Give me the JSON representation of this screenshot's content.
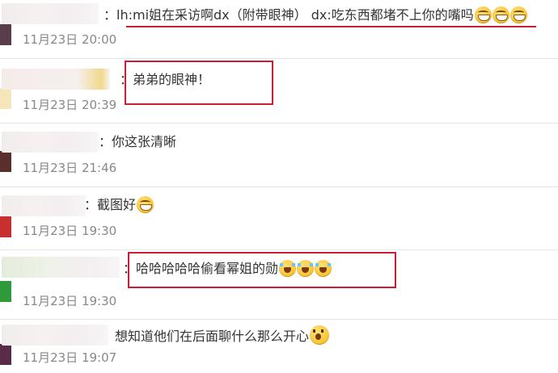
{
  "comments": [
    {
      "text": "：lh:mi姐在采访啊dx（附带眼神） dx:吃东西都堵不上你的嘴吗",
      "emojis": [
        "grin-icon",
        "grin-icon",
        "grin-icon"
      ],
      "date": "11月23日 20:00"
    },
    {
      "text": "：弟弟的眼神！",
      "emojis": [],
      "date": "11月23日 20:39"
    },
    {
      "text": "：你这张清晰",
      "emojis": [],
      "date": "11月23日 21:46"
    },
    {
      "text": "：截图好",
      "emojis": [
        "grin-icon"
      ],
      "date": "11月23日 19:30"
    },
    {
      "text": "：哈哈哈哈哈偷看幂姐的勋",
      "emojis": [
        "tears-of-joy-icon",
        "tears-of-joy-icon",
        "tears-of-joy-icon"
      ],
      "date": "11月23日 19:30"
    },
    {
      "text": "想知道他们在后面聊什么那么开心",
      "emojis": [
        "shocked-face-icon"
      ],
      "date": "11月23日 19:07"
    }
  ],
  "colors": {
    "highlight_red": "#c8202e",
    "date_gray": "#888888",
    "divider": "#e4e4e4"
  }
}
